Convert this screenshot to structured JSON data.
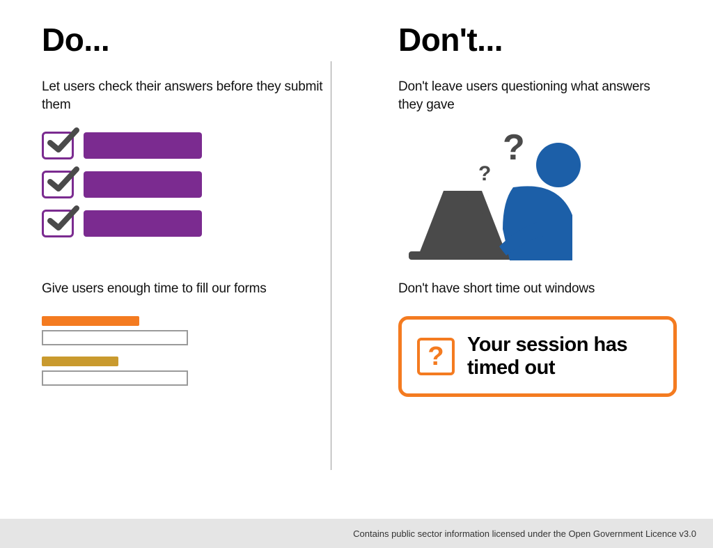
{
  "left": {
    "heading": "Do...",
    "tip1": "Let users check their answers before they submit them",
    "tip2": "Give users enough time to fill our forms"
  },
  "right": {
    "heading": "Don't...",
    "tip1": "Don't leave users questioning what answers they gave",
    "tip2": "Don't have short time out windows",
    "timeout_message": "Your session has timed out"
  },
  "footer": "Contains public sector information licensed under the Open Government Licence v3.0"
}
